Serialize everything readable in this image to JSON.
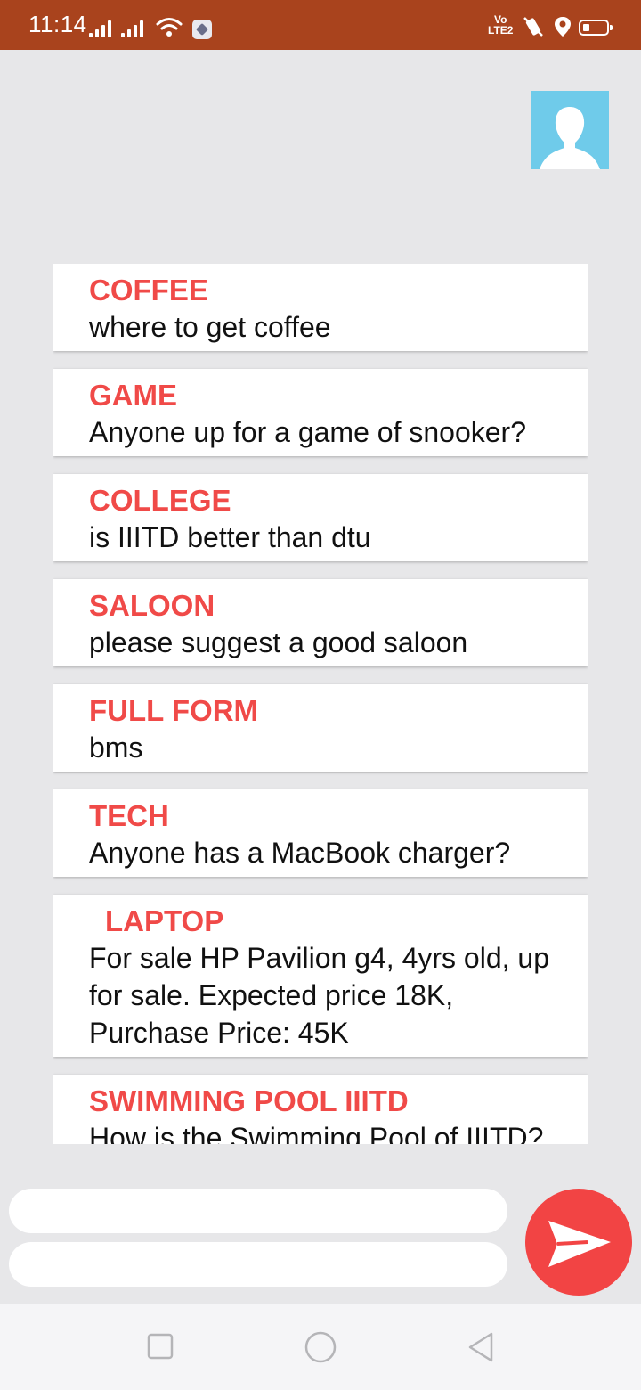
{
  "status_bar": {
    "time": "11:14",
    "volte": [
      "Vo",
      "LTE2"
    ]
  },
  "posts": [
    {
      "title": "COFFEE",
      "body": "where to get coffee"
    },
    {
      "title": "GAME",
      "body": "Anyone up for a game of snooker?"
    },
    {
      "title": "COLLEGE",
      "body": "is IIITD better than dtu"
    },
    {
      "title": "SALOON",
      "body": "please suggest a good saloon"
    },
    {
      "title": "FULL FORM",
      "body": "bms"
    },
    {
      "title": "TECH",
      "body": "Anyone has a MacBook charger?"
    },
    {
      "title": "LAPTOP",
      "body": "For sale HP Pavilion g4, 4yrs old, up for sale. Expected price 18K, Purchase Price: 45K"
    },
    {
      "title": "SWIMMING POOL IIITD",
      "body": "How is the Swimming Pool of IIITD?"
    }
  ],
  "composer": {
    "title_value": "",
    "body_value": ""
  },
  "colors": {
    "status_bar": "#a9431d",
    "accent": "#f04a48",
    "avatar_bg": "#6fcbea",
    "send_button": "#f24444"
  },
  "icons": {
    "avatar": "user-silhouette-icon",
    "send": "send-arrow-icon",
    "nav_recents": "square-icon",
    "nav_home": "circle-icon",
    "nav_back": "triangle-back-icon"
  }
}
